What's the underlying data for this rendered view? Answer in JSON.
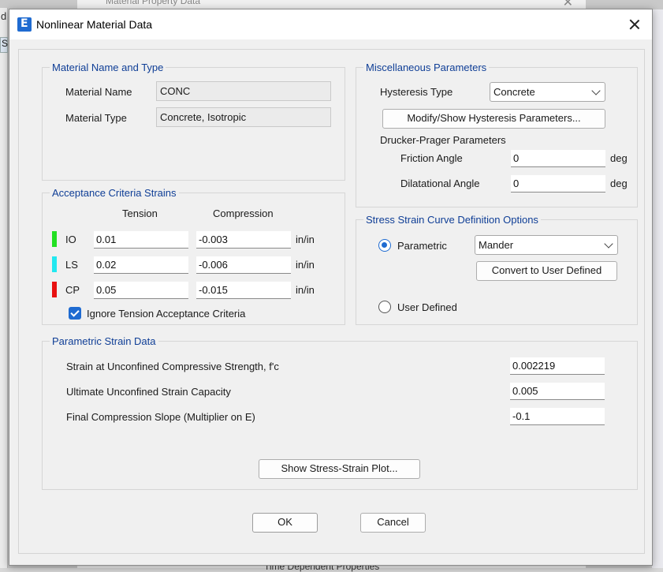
{
  "background": {
    "window_title": "Material Property Data",
    "left_letter_1": "d",
    "left_letter_2": "S",
    "bottom_text": "Time Dependent Properties"
  },
  "dialog": {
    "title": "Nonlinear Material Data"
  },
  "material": {
    "group_title": "Material Name and Type",
    "name_label": "Material Name",
    "name_value": "CONC",
    "type_label": "Material Type",
    "type_value": "Concrete, Isotropic"
  },
  "acceptance": {
    "group_title": "Acceptance Criteria Strains",
    "col_tension": "Tension",
    "col_compression": "Compression",
    "rows": [
      {
        "label": "IO",
        "tension": "0.01",
        "compression": "-0.003",
        "unit": "in/in",
        "color": "#22e022"
      },
      {
        "label": "LS",
        "tension": "0.02",
        "compression": "-0.006",
        "unit": "in/in",
        "color": "#22e8f0"
      },
      {
        "label": "CP",
        "tension": "0.05",
        "compression": "-0.015",
        "unit": "in/in",
        "color": "#e81010"
      }
    ],
    "ignore_label": "Ignore Tension Acceptance Criteria",
    "ignore_checked": true
  },
  "misc": {
    "group_title": "Miscellaneous Parameters",
    "hysteresis_label": "Hysteresis Type",
    "hysteresis_value": "Concrete",
    "modify_button": "Modify/Show Hysteresis Parameters...",
    "drucker_label": "Drucker-Prager Parameters",
    "friction_label": "Friction Angle",
    "friction_value": "0",
    "friction_unit": "deg",
    "dilatational_label": "Dilatational Angle",
    "dilatational_value": "0",
    "dilatational_unit": "deg"
  },
  "stress_strain": {
    "group_title": "Stress Strain Curve Definition Options",
    "parametric_label": "Parametric",
    "parametric_selected": true,
    "parametric_model": "Mander",
    "convert_button": "Convert to User Defined",
    "user_defined_label": "User Defined"
  },
  "parametric_strain": {
    "group_title": "Parametric Strain Data",
    "strain_fc_label": "Strain at Unconfined Compressive Strength, f'c",
    "strain_fc_value": "0.002219",
    "ultimate_label": "Ultimate Unconfined Strain Capacity",
    "ultimate_value": "0.005",
    "slope_label": "Final Compression Slope (Multiplier on E)",
    "slope_value": "-0.1",
    "plot_button": "Show Stress-Strain Plot..."
  },
  "footer": {
    "ok_button": "OK",
    "cancel_button": "Cancel"
  }
}
